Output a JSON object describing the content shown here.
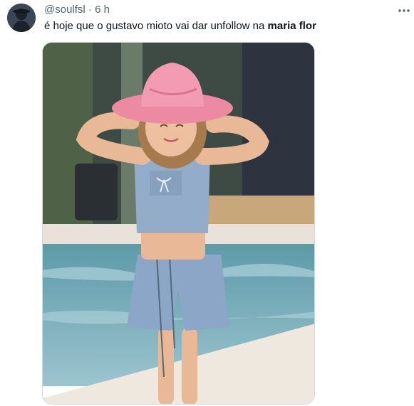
{
  "tweet": {
    "username": "@soulfsl",
    "separator": "·",
    "time": "6 h",
    "text_prefix": "é hoje que o gustavo mioto vai dar unfollow na ",
    "text_bold": "maria flor",
    "more_icon": "more-horizontal-icon"
  },
  "colors": {
    "secondary_text": "#536471",
    "primary_text": "#0f1419",
    "hat": "#ef8fa8",
    "denim": "#8fa9c8"
  }
}
